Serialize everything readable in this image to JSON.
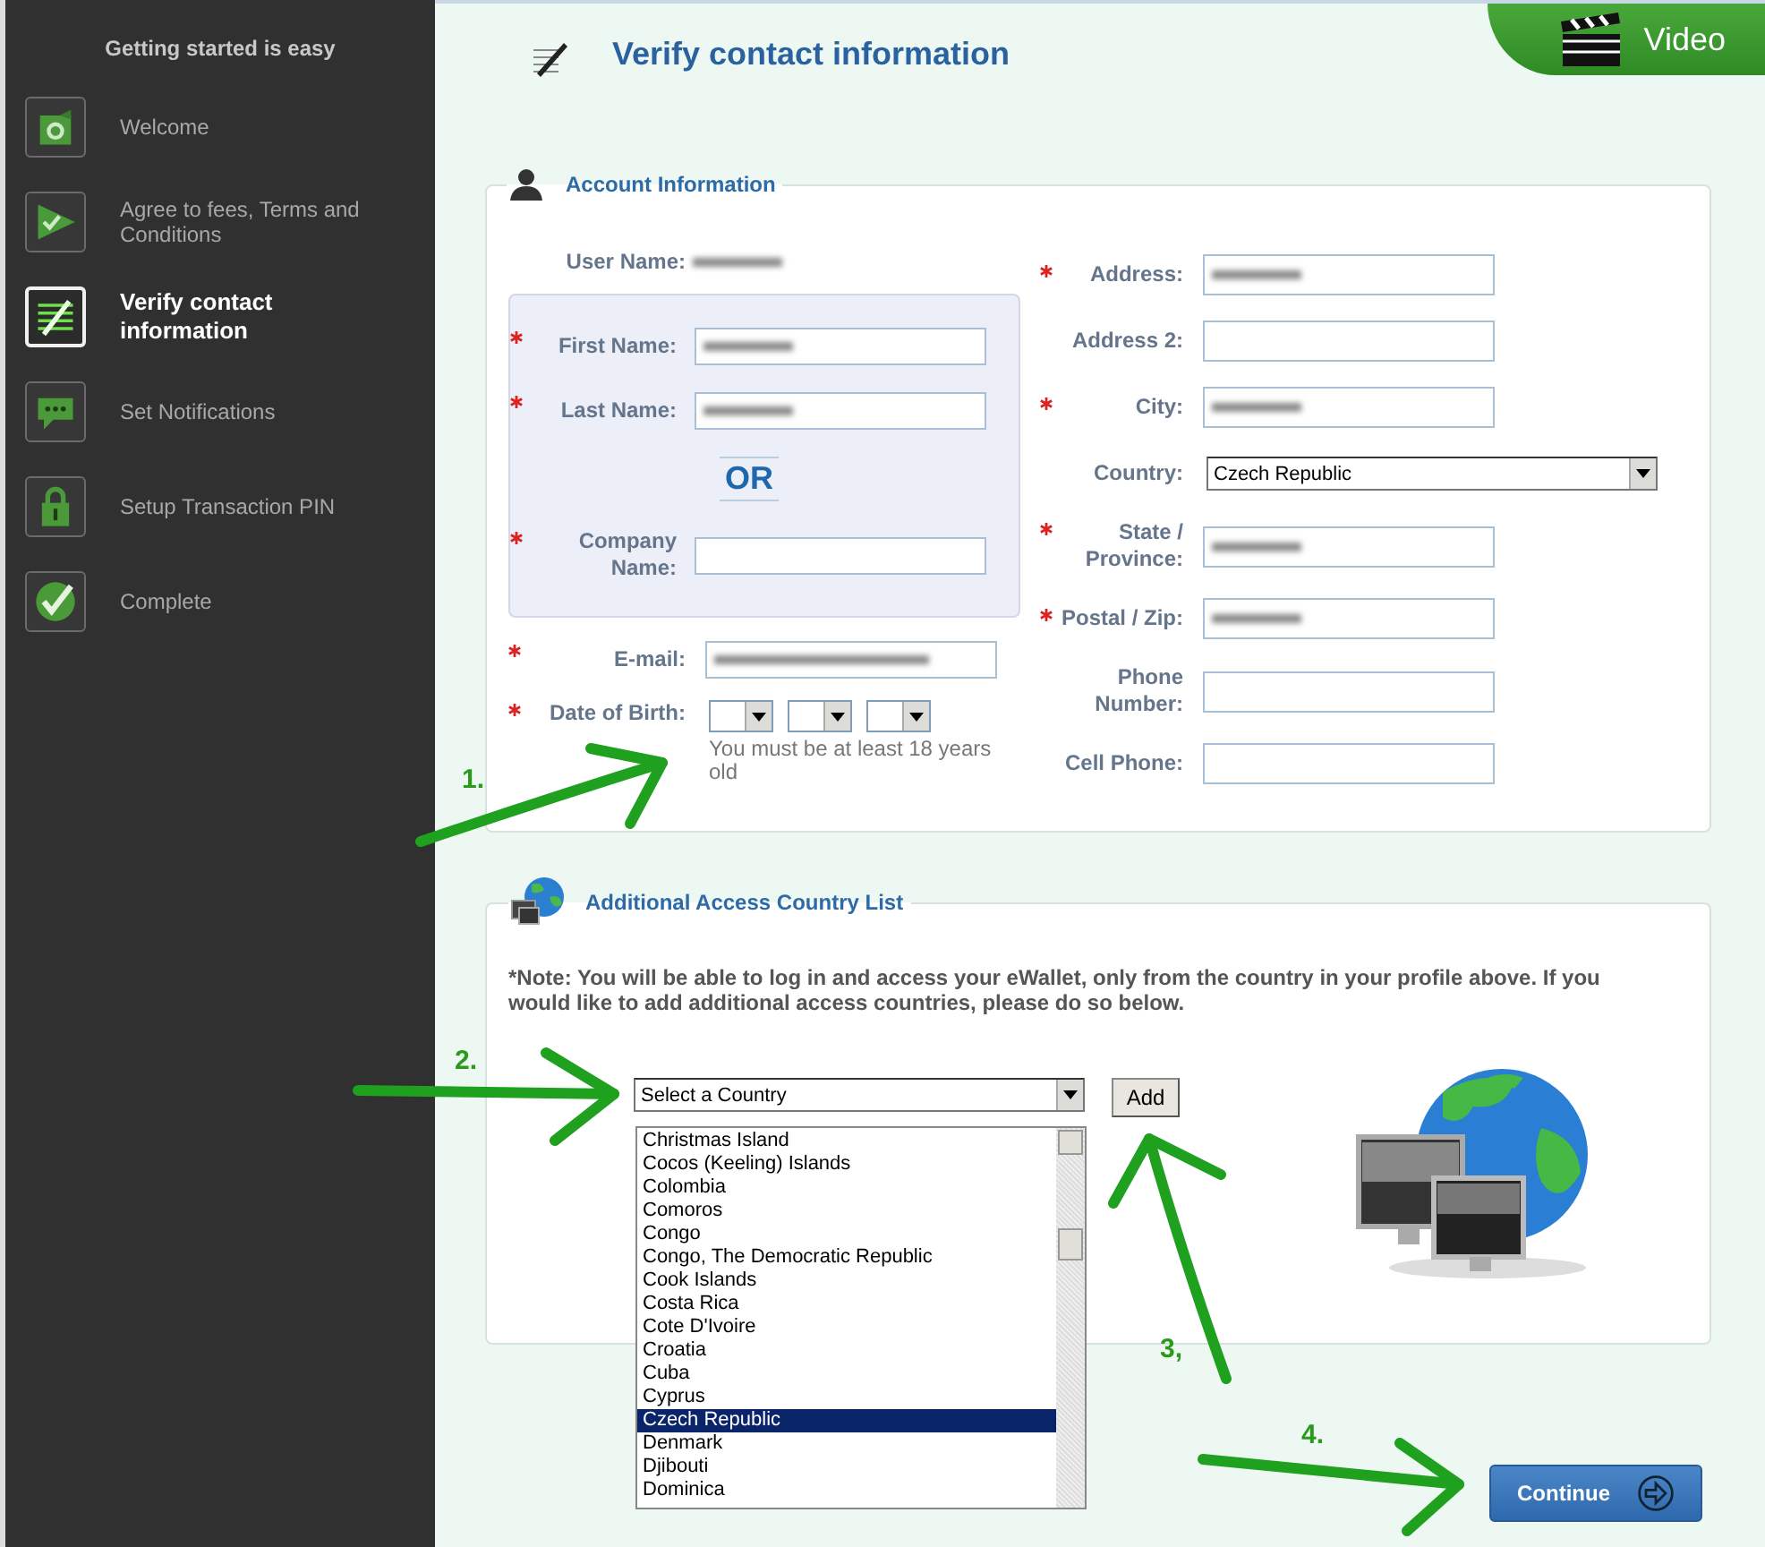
{
  "sidebar": {
    "title": "Getting started is easy",
    "steps": [
      {
        "label": "Welcome",
        "kind": "welcome",
        "selected": false
      },
      {
        "label": "Agree to fees, Terms and Conditions",
        "kind": "terms",
        "selected": false
      },
      {
        "label": "Verify contact information",
        "kind": "verify",
        "selected": true
      },
      {
        "label": "Set Notifications",
        "kind": "notifications",
        "selected": false
      },
      {
        "label": "Setup Transaction PIN",
        "kind": "pin",
        "selected": false
      },
      {
        "label": "Complete",
        "kind": "complete",
        "selected": false
      }
    ]
  },
  "header": {
    "title": "Verify contact information",
    "video": "Video"
  },
  "account": {
    "title": "Account Information",
    "user_name": {
      "label": "User Name:",
      "redacted": true
    },
    "name_group": [
      {
        "label": "First Name:",
        "required": true,
        "redacted": true
      },
      {
        "label": "Last Name:",
        "required": true,
        "redacted": true
      },
      {
        "label": "Company Name:",
        "required": true,
        "redacted": false
      }
    ],
    "or": "OR",
    "email": {
      "label": "E-mail:",
      "required": true,
      "redacted": true
    },
    "birth": {
      "label": "Date of Birth:",
      "required": true,
      "hint": "You must be at least 18 years old"
    },
    "right_fields": [
      {
        "label": "Address:",
        "required": true,
        "kind": "input",
        "redacted": true
      },
      {
        "label": "Address 2:",
        "required": false,
        "kind": "input",
        "redacted": false
      },
      {
        "label": "City:",
        "required": true,
        "kind": "input",
        "redacted": true
      },
      {
        "label": "Country:",
        "required": false,
        "kind": "select",
        "value": "Czech Republic"
      },
      {
        "label": "State / Province:",
        "required": true,
        "kind": "input",
        "redacted": true
      },
      {
        "label": "Postal / Zip:",
        "required": true,
        "kind": "input",
        "redacted": true
      },
      {
        "label": "Phone Number:",
        "required": false,
        "kind": "input",
        "redacted": false
      },
      {
        "label": "Cell Phone:",
        "required": false,
        "kind": "input",
        "redacted": false
      }
    ]
  },
  "access": {
    "title": "Additional Access Country List",
    "note": "*Note: You will be able to log in and access your eWallet, only from the country in your profile above. If you would like to add additional access countries, please do so below.",
    "select": "Select a Country",
    "add": "Add",
    "options": [
      {
        "label": "Christmas Island",
        "selected": false
      },
      {
        "label": "Cocos (Keeling) Islands",
        "selected": false
      },
      {
        "label": "Colombia",
        "selected": false
      },
      {
        "label": "Comoros",
        "selected": false
      },
      {
        "label": "Congo",
        "selected": false
      },
      {
        "label": "Congo, The Democratic Republic",
        "selected": false
      },
      {
        "label": "Cook Islands",
        "selected": false
      },
      {
        "label": "Costa Rica",
        "selected": false
      },
      {
        "label": "Cote D'Ivoire",
        "selected": false
      },
      {
        "label": "Croatia",
        "selected": false
      },
      {
        "label": "Cuba",
        "selected": false
      },
      {
        "label": "Cyprus",
        "selected": false
      },
      {
        "label": "Czech Republic",
        "selected": true
      },
      {
        "label": "Denmark",
        "selected": false
      },
      {
        "label": "Djibouti",
        "selected": false
      },
      {
        "label": "Dominica",
        "selected": false
      }
    ]
  },
  "continue": "Continue",
  "annotations": [
    {
      "label": "1."
    },
    {
      "label": "2."
    },
    {
      "label": "3,"
    },
    {
      "label": "4."
    }
  ]
}
